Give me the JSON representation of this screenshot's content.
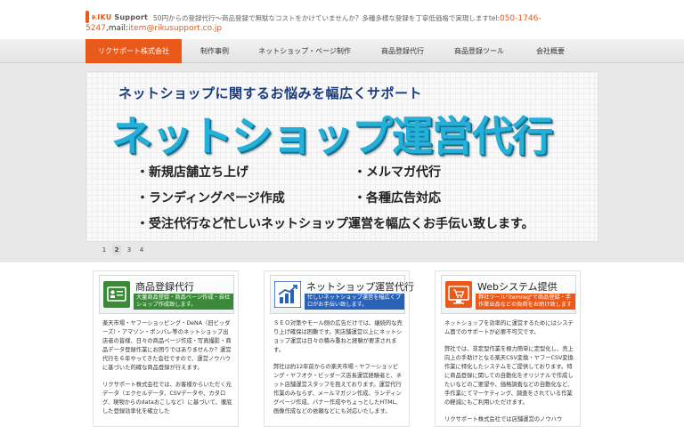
{
  "header": {
    "logo_brand": "RIKU",
    "logo_suffix": "Support",
    "tagline": "50円からの登録代行〜商品登録で無駄なコストをかけていませんか？多種多様な登録を丁寧低価格で実現しますtel:",
    "tel_part1": "050-1746-",
    "tel_part2": "5247",
    "mail_label": ",mail:",
    "mail": "item@rikusupport.co.jp"
  },
  "nav": {
    "items": [
      {
        "label": "リクサポート株式会社",
        "active": true
      },
      {
        "label": "制作事例",
        "active": false
      },
      {
        "label": "ネットショップ・ページ制作",
        "active": false
      },
      {
        "label": "商品登録代行",
        "active": false
      },
      {
        "label": "商品登録ツール",
        "active": false
      },
      {
        "label": "会社概要",
        "active": false
      }
    ]
  },
  "hero": {
    "subtitle": "ネットショップに関するお悩みを幅広くサポート",
    "title": "ネットショップ運営代行",
    "bullets": [
      "・新規店舗立ち上げ",
      "・メルマガ代行",
      "・ランディングページ作成",
      "・各種広告対応",
      "・受注代行など忙しいネットショップ運営を幅広くお手伝い致します。"
    ]
  },
  "pager": {
    "items": [
      "1",
      "2",
      "3",
      "4"
    ],
    "active": "2"
  },
  "cards": [
    {
      "title": "商品登録代行",
      "desc": "大量商品登録・商品ページ作成・自社ショップ作成致します。",
      "icon": "product-registration-icon",
      "icon_color": "#3a8a3a",
      "desc_color": "#3a8a3a",
      "paragraphs": [
        "楽天市場・ヤフーショッピング・DeNA（旧ビッダーズ）・アマゾン・ポンパレ等のネットショップ出店者の皆様、日々の商品ページ作成・写真撮影・商品データ登録作業にお困りではありませんか？運営代行を６年やってきた会社ですので、運営ノウハウに基づいた的確な商品登録が行えます。",
        "リクサポート株式会社では、お客様からいただく元データ（エクセルデータ、CSVデータや、カタログ、現物からのdataおこしなど）に基づいて、徹底した登録効率化を確立した"
      ]
    },
    {
      "title": "ネットショップ運営代行",
      "desc": "忙しいネットショップ運営を幅広くプロがお手伝い致します。",
      "icon": "bar-chart-icon",
      "icon_color": "#2a62b8",
      "desc_color": "#2a62b8",
      "paragraphs": [
        "ＳＥＯ対策やモール側の広告だけでは、継続的な売り上げ確保は困難です。実店舗運営以上にネットショップ運営は日々の積み重ねと経験が要求されます。",
        "弊社は約12年前からの楽天市場・ヤフーショッピング・ヤフオク・ビッダーズ店長運営経験者と、ネット店舗運営スタッフを抱えております。運営代行作業のみならず、メールマガジン作成、ランディングページ作成、バナー作成やちょっとしたHTML、画像作成などの依頼などにも対応いたします。"
      ]
    },
    {
      "title": "Webシステム提供",
      "desc": "弊社ツール\"itemreg\"で商品登録・手作業出品などの負荷をお助け致します",
      "icon": "cart-icon",
      "icon_color": "#e8591a",
      "desc_color": "#e8591a",
      "paragraphs": [
        "ネットショップを効率的に運営するためにはシステム面でのサポートが必要不可欠です。",
        "弊社では、非定型作業を極力簡単に定型化し、売上向上の手助けとなる楽天CSV変換・ヤフーCSV変換作業に特化したシステムをご提供しております。特に商品登録に関しての自動化をオリジナルで作成したいなどのご要望や、価格調査などの自動化など、手作業にてマーケティング、調査をされている作業の軽減にもご利用いただけます。",
        "リクサポート株式会社では店舗運営のノウハウ"
      ]
    }
  ]
}
